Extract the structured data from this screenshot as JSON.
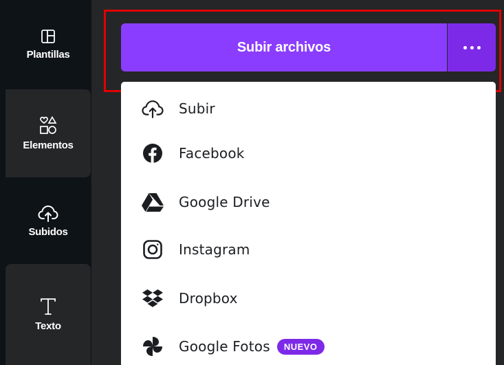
{
  "sidebar": {
    "items": [
      {
        "label": "Plantillas",
        "icon": "templates-icon"
      },
      {
        "label": "Elementos",
        "icon": "elements-icon"
      },
      {
        "label": "Subidos",
        "icon": "upload-cloud-icon"
      },
      {
        "label": "Texto",
        "icon": "text-icon"
      }
    ]
  },
  "upload": {
    "button_label": "Subir archivos",
    "more_icon": "more-dots-icon"
  },
  "menu": {
    "items": [
      {
        "label": "Subir",
        "icon": "upload-cloud-icon"
      },
      {
        "label": "Facebook",
        "icon": "facebook-icon"
      },
      {
        "label": "Google Drive",
        "icon": "google-drive-icon"
      },
      {
        "label": "Instagram",
        "icon": "instagram-icon"
      },
      {
        "label": "Dropbox",
        "icon": "dropbox-icon"
      },
      {
        "label": "Google Fotos",
        "icon": "google-photos-icon",
        "badge": "NUEVO"
      }
    ]
  },
  "colors": {
    "accent": "#8b3dff",
    "accent_dark": "#7d2ae8",
    "sidebar_bg": "#0e1318",
    "panel_bg": "#252627",
    "highlight": "#e00000"
  }
}
